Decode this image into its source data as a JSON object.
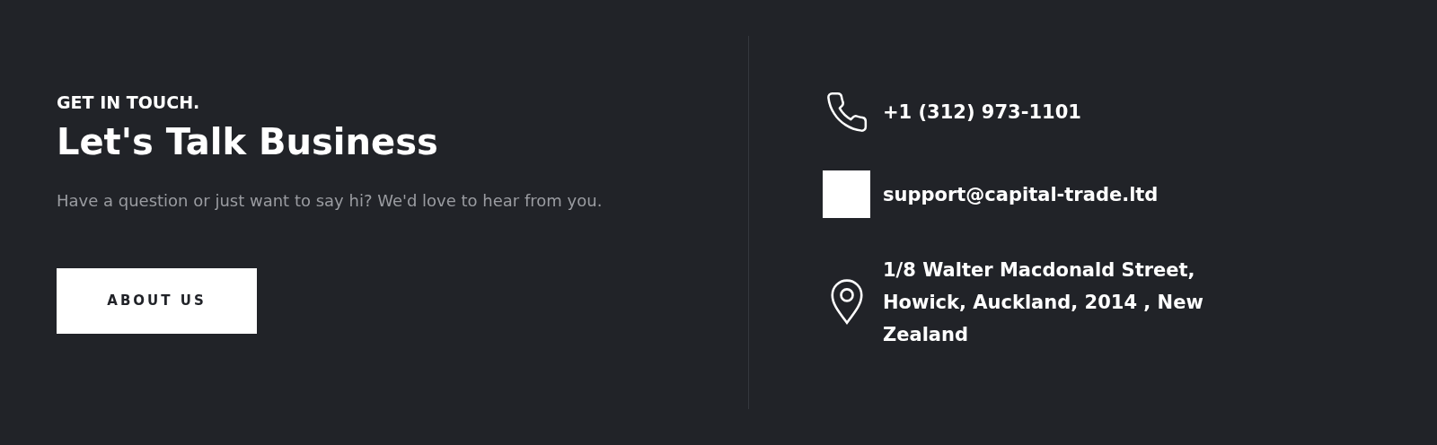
{
  "intro": {
    "eyebrow": "GET IN TOUCH.",
    "heading": "Let's Talk Business",
    "text": "Have a question or just want to say hi? We'd love to hear from you.",
    "button": "ABOUT US"
  },
  "contacts": [
    {
      "kind": "phone",
      "text": "+1 (312) 973-1101"
    },
    {
      "kind": "email",
      "text": "support@capital-trade.ltd"
    },
    {
      "kind": "address",
      "text": "1/8 Walter Macdonald Street, Howick, Auckland, 2014 , New Zealand"
    }
  ]
}
